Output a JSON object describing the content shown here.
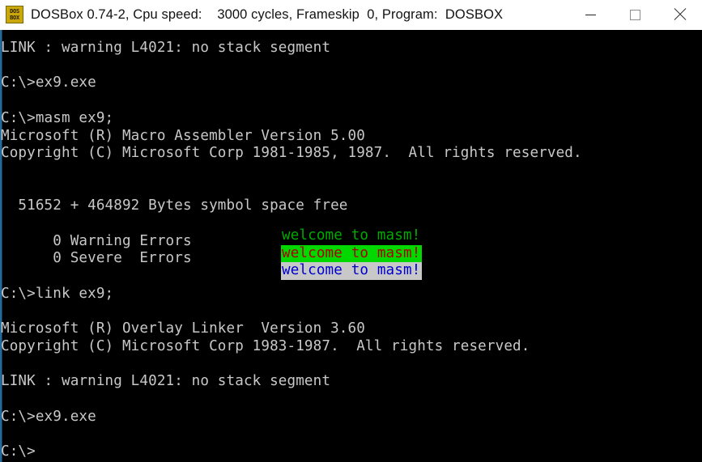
{
  "window": {
    "title": "DOSBox 0.74-2, Cpu speed:    3000 cycles, Frameskip  0, Program:  DOSBOX",
    "icon_line_1": "DOS",
    "icon_line_2": "BOX",
    "controls": {
      "minimize": "minimize-button",
      "maximize": "maximize-button",
      "close": "close-button"
    }
  },
  "console": {
    "background_color": "#000000",
    "foreground_color": "#c8c8c8",
    "lines": [
      "LINK : warning L4021: no stack segment",
      "",
      "C:\\>ex9.exe",
      "",
      "C:\\>masm ex9;",
      "Microsoft (R) Macro Assembler Version 5.00",
      "Copyright (C) Microsoft Corp 1981-1985, 1987.  All rights reserved.",
      "",
      "",
      "  51652 + 464892 Bytes symbol space free",
      "",
      "      0 Warning Errors",
      "      0 Severe  Errors",
      "",
      "C:\\>link ex9;",
      "",
      "Microsoft (R) Overlay Linker  Version 3.60",
      "Copyright (C) Microsoft Corp 1983-1987.  All rights reserved.",
      "",
      "LINK : warning L4021: no stack segment",
      "",
      "C:\\>ex9.exe",
      "",
      "C:\\>"
    ],
    "highlight_block": {
      "lines": [
        {
          "text": "welcome to masm!",
          "fg": "#00aa00",
          "bg": "#000000"
        },
        {
          "text": "welcome to masm!",
          "fg": "#aa0000",
          "bg": "#00d800"
        },
        {
          "text": "welcome to masm!",
          "fg": "#0000cc",
          "bg": "#c8c8c8"
        }
      ]
    }
  }
}
